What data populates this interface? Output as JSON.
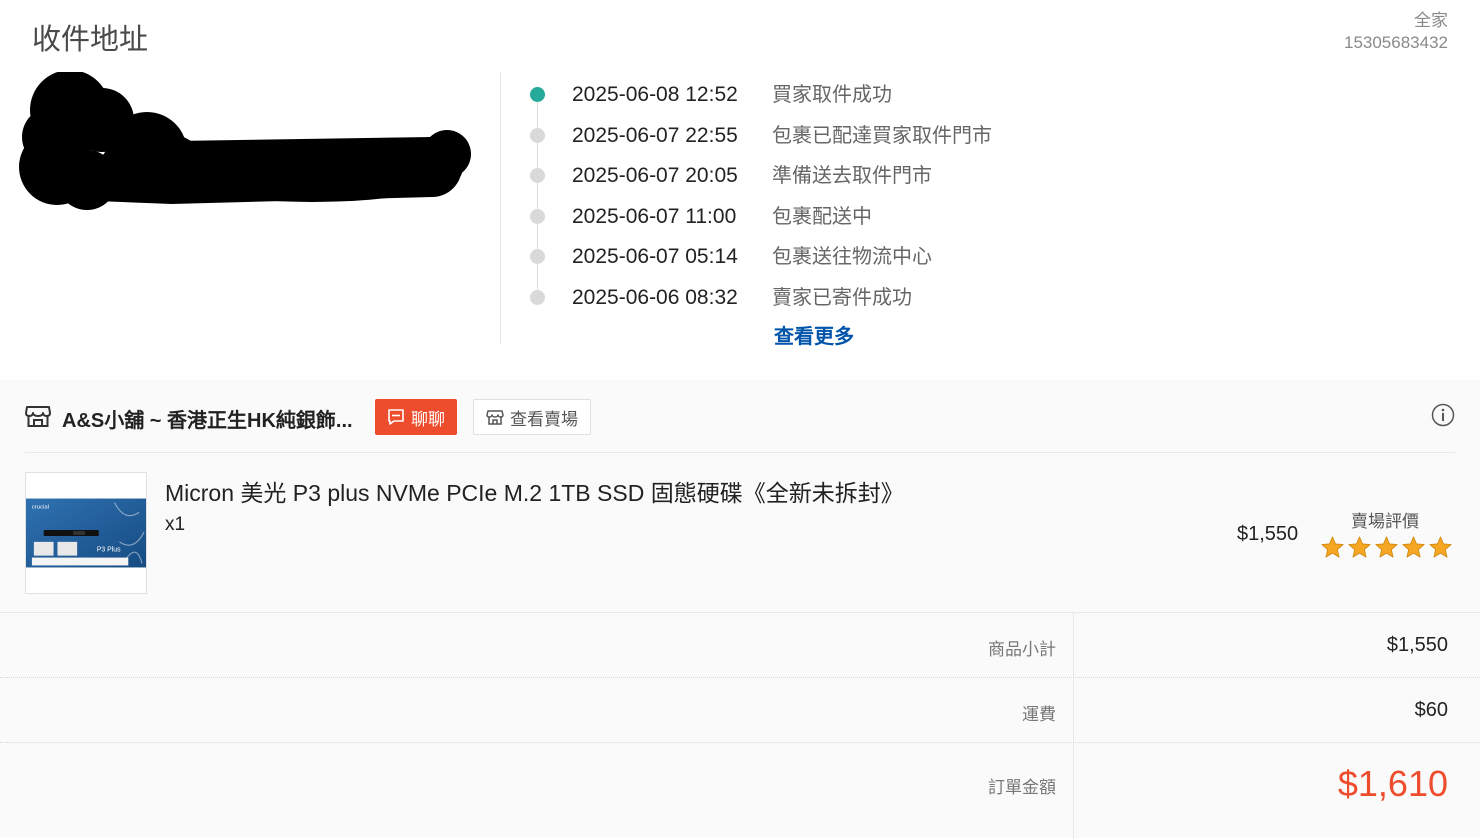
{
  "address": {
    "title": "收件地址",
    "pickup_store": "全家",
    "phone": "15305683432"
  },
  "tracking": {
    "events": [
      {
        "time": "2025-06-08 12:52",
        "status": "買家取件成功",
        "active": true
      },
      {
        "time": "2025-06-07 22:55",
        "status": "包裹已配達買家取件門市",
        "active": false
      },
      {
        "time": "2025-06-07 20:05",
        "status": "準備送去取件門市",
        "active": false
      },
      {
        "time": "2025-06-07 11:00",
        "status": "包裹配送中",
        "active": false
      },
      {
        "time": "2025-06-07 05:14",
        "status": "包裹送往物流中心",
        "active": false
      },
      {
        "time": "2025-06-06 08:32",
        "status": "賣家已寄件成功",
        "active": false
      }
    ],
    "more_label": "查看更多"
  },
  "shop": {
    "name": "A&S小舖 ~ 香港正生HK純銀飾...",
    "chat_label": "聊聊",
    "view_shop_label": "查看賣場"
  },
  "product": {
    "title": "Micron 美光 P3 plus NVMe PCIe M.2 1TB SSD 固態硬碟《全新未拆封》",
    "quantity": "x1",
    "price": "$1,550",
    "rating_label": "賣場評價",
    "rating": 5,
    "image_brand": "crucial",
    "image_model": "P3 Plus"
  },
  "totals": {
    "subtotal_label": "商品小計",
    "subtotal_value": "$1,550",
    "shipping_label": "運費",
    "shipping_value": "$60",
    "order_total_label": "訂單金額",
    "order_total_value": "$1,610"
  },
  "colors": {
    "accent": "#ee4d2d",
    "active_dot": "#26aa99",
    "link": "#0055aa",
    "star": "#f5a623"
  }
}
